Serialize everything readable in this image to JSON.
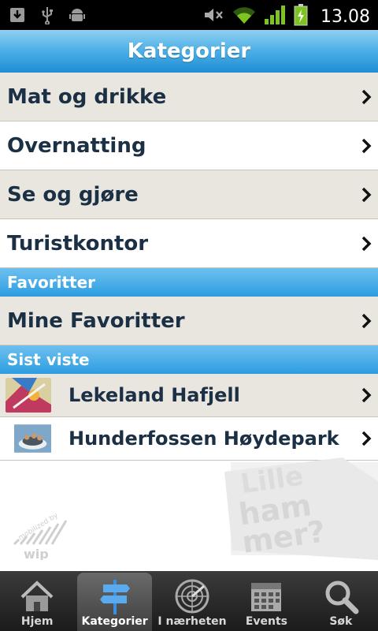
{
  "status_bar": {
    "clock": "13.08",
    "icons": [
      "download-icon",
      "usb-icon",
      "android-debug-icon",
      "mute-icon",
      "wifi-icon",
      "signal-icon",
      "battery-charging-icon"
    ]
  },
  "title": "Kategorier",
  "categories": [
    {
      "label": "Mat og drikke"
    },
    {
      "label": "Overnatting"
    },
    {
      "label": "Se og gjøre"
    },
    {
      "label": "Turistkontor"
    }
  ],
  "favorites": {
    "header": "Favoritter",
    "items": [
      {
        "label": "Mine Favoritter"
      }
    ]
  },
  "recent": {
    "header": "Sist viste",
    "items": [
      {
        "label": "Lekeland Hafjell"
      },
      {
        "label": "Hunderfossen Høydepark"
      }
    ]
  },
  "watermark": {
    "brand": "Lillehammer",
    "credit": "mobilized by wip"
  },
  "tabs": [
    {
      "label": "Hjem",
      "icon": "home-icon",
      "active": false
    },
    {
      "label": "Kategorier",
      "icon": "signpost-icon",
      "active": true
    },
    {
      "label": "I nærheten",
      "icon": "radar-icon",
      "active": false
    },
    {
      "label": "Events",
      "icon": "calendar-icon",
      "active": false
    },
    {
      "label": "Søk",
      "icon": "search-icon",
      "active": false
    }
  ],
  "colors": {
    "title_bar": "#4aaee6",
    "row_alt": "#e8e6df",
    "text_dark": "#1b2f45"
  }
}
